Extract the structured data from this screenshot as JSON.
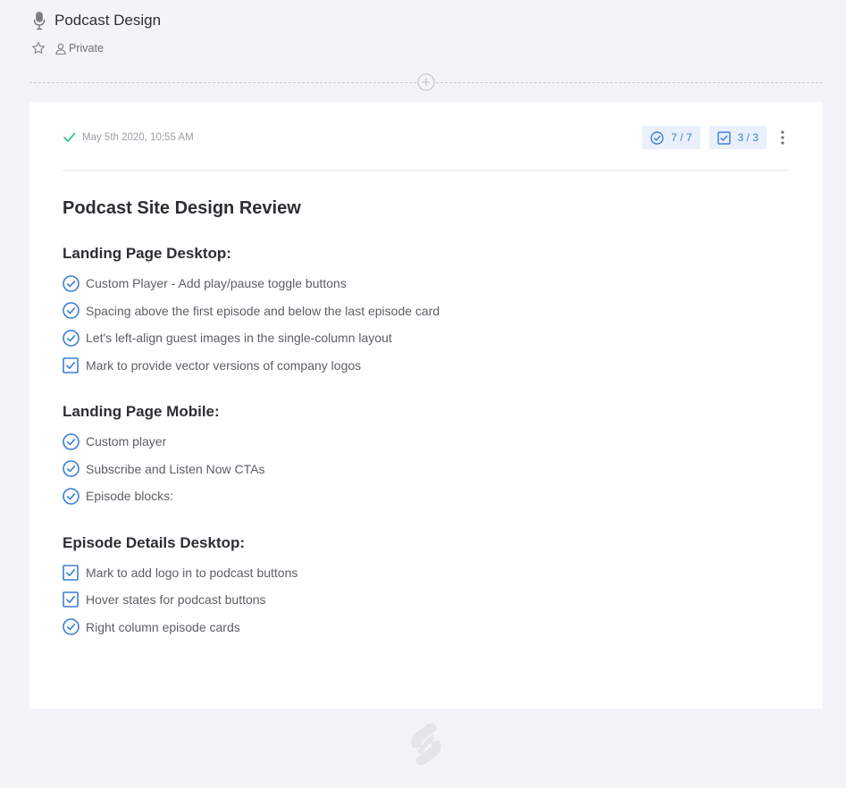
{
  "page": {
    "title": "Podcast Design",
    "visibility": "Private",
    "icon": "microphone-icon"
  },
  "entry": {
    "timestamp": "May 5th 2020, 10:55 AM",
    "status_icon": "check-icon",
    "badges": {
      "todos": "7 / 7",
      "checks": "3 / 3"
    }
  },
  "document": {
    "title": "Podcast Site Design Review",
    "sections": [
      {
        "heading": "Landing Page Desktop:",
        "items": [
          {
            "type": "circle",
            "text": "Custom Player - Add play/pause toggle buttons"
          },
          {
            "type": "circle",
            "text": "Spacing above the first episode and below the last episode card"
          },
          {
            "type": "circle",
            "text": "Let's left-align guest images in the single-column layout"
          },
          {
            "type": "square",
            "text": "Mark to provide vector versions of company logos"
          }
        ]
      },
      {
        "heading": "Landing Page Mobile:",
        "items": [
          {
            "type": "circle",
            "text": "Custom player"
          },
          {
            "type": "circle",
            "text": "Subscribe and Listen Now CTAs"
          },
          {
            "type": "circle",
            "text": "Episode blocks:"
          }
        ]
      },
      {
        "heading": "Episode Details Desktop:",
        "items": [
          {
            "type": "square",
            "text": "Mark to add logo in to podcast buttons"
          },
          {
            "type": "square",
            "text": "Hover states for podcast buttons"
          },
          {
            "type": "circle",
            "text": "Right column episode cards"
          }
        ]
      }
    ]
  },
  "colors": {
    "accent": "#3a7fd6",
    "check_green": "#3bc08a",
    "background": "#f3f4f7"
  }
}
